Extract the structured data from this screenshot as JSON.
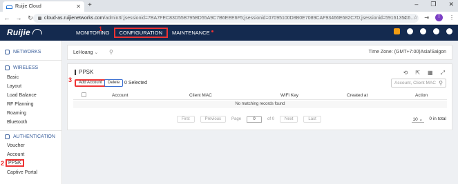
{
  "browser": {
    "tab_title": "Ruijie Cloud",
    "new_tab": "+",
    "window_controls": [
      "–",
      "❐",
      "✕"
    ],
    "url_host": "cloud-as.ruijienetworks.com",
    "url_path": "/admin3/;jsessionid=7BA7FEC83D55B795BD55A9C7B6EEE6F5;jsessionid=07095100D8B0E7089CAF93466E682C7D;jsessionid=5916135C6...",
    "profile_initial": "T"
  },
  "app": {
    "logo": "Ruijie",
    "nav": {
      "monitoring": "MONITORING",
      "configuration": "CONFIGURATION",
      "maintenance": "MAINTENANCE"
    }
  },
  "callouts": {
    "one": "1",
    "two": "2",
    "three": "3"
  },
  "sidebar": {
    "networks": "NETWORKS",
    "wireless": "WIRELESS",
    "wireless_items": [
      "Basic",
      "Layout",
      "Load Balance",
      "RF Planning",
      "Roaming",
      "Bluetooth"
    ],
    "authentication": "AUTHENTICATION",
    "auth_items": [
      "Voucher",
      "Account",
      "PPSK",
      "Captive Portal"
    ]
  },
  "topbar": {
    "group": "LeHoang",
    "timezone": "Time Zone: (GMT+7:00)Asia/Saigon"
  },
  "panel": {
    "title": "PPSK",
    "add_button": "Add Account",
    "delete_button": "Delete",
    "selected": "0 Selected",
    "search_placeholder": "Account, Client MAC",
    "columns": [
      "Account",
      "Client MAC",
      "WiFi Key",
      "Created at",
      "Action"
    ],
    "empty_message": "No matching records found",
    "pager": {
      "first": "First",
      "previous": "Previous",
      "page_label": "Page",
      "page_value": "0",
      "of_label": "of 0",
      "next": "Next",
      "last": "Last"
    },
    "page_size": "10",
    "total": "0 in total"
  }
}
